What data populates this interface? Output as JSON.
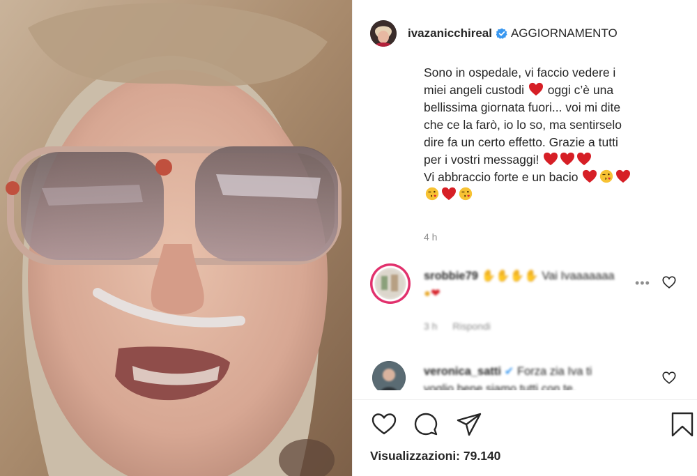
{
  "media": {
    "description_icon": "video-frame"
  },
  "post": {
    "username": "ivazanicchireal",
    "status_label": "AGGIORNAMENTO",
    "caption_lines": [
      "Sono in ospedale, vi faccio vedere i",
      "miei angeli custodi",
      "oggi c’è una",
      "bellissima giornata fuori... voi mi dite",
      "che ce la farò, io lo so, ma sentirselo",
      "dire fa un certo effetto. Grazie a tutti",
      "per i vostri messaggi!",
      "Vi abbraccio forte e un bacio"
    ],
    "time": "4 h"
  },
  "comments": [
    {
      "username": "srobbie79",
      "text": "Vai Ivaaaaaaa",
      "time": "3 h",
      "reply_label": "Rispondi"
    },
    {
      "username": "veronica_satti",
      "text": "Forza zia Iva ti voglio bene siamo tutti con te."
    }
  ],
  "footer": {
    "views_label": "Visualizzazioni:",
    "views_count": "79.140"
  },
  "colors": {
    "accent": "#3897f0",
    "heart": "#ed4956",
    "text": "#262626",
    "muted": "#8e8e8e"
  },
  "icons": [
    "verified-badge-icon",
    "heart-icon",
    "comment-icon",
    "share-icon",
    "bookmark-icon",
    "more-options-icon",
    "like-comment-icon"
  ]
}
